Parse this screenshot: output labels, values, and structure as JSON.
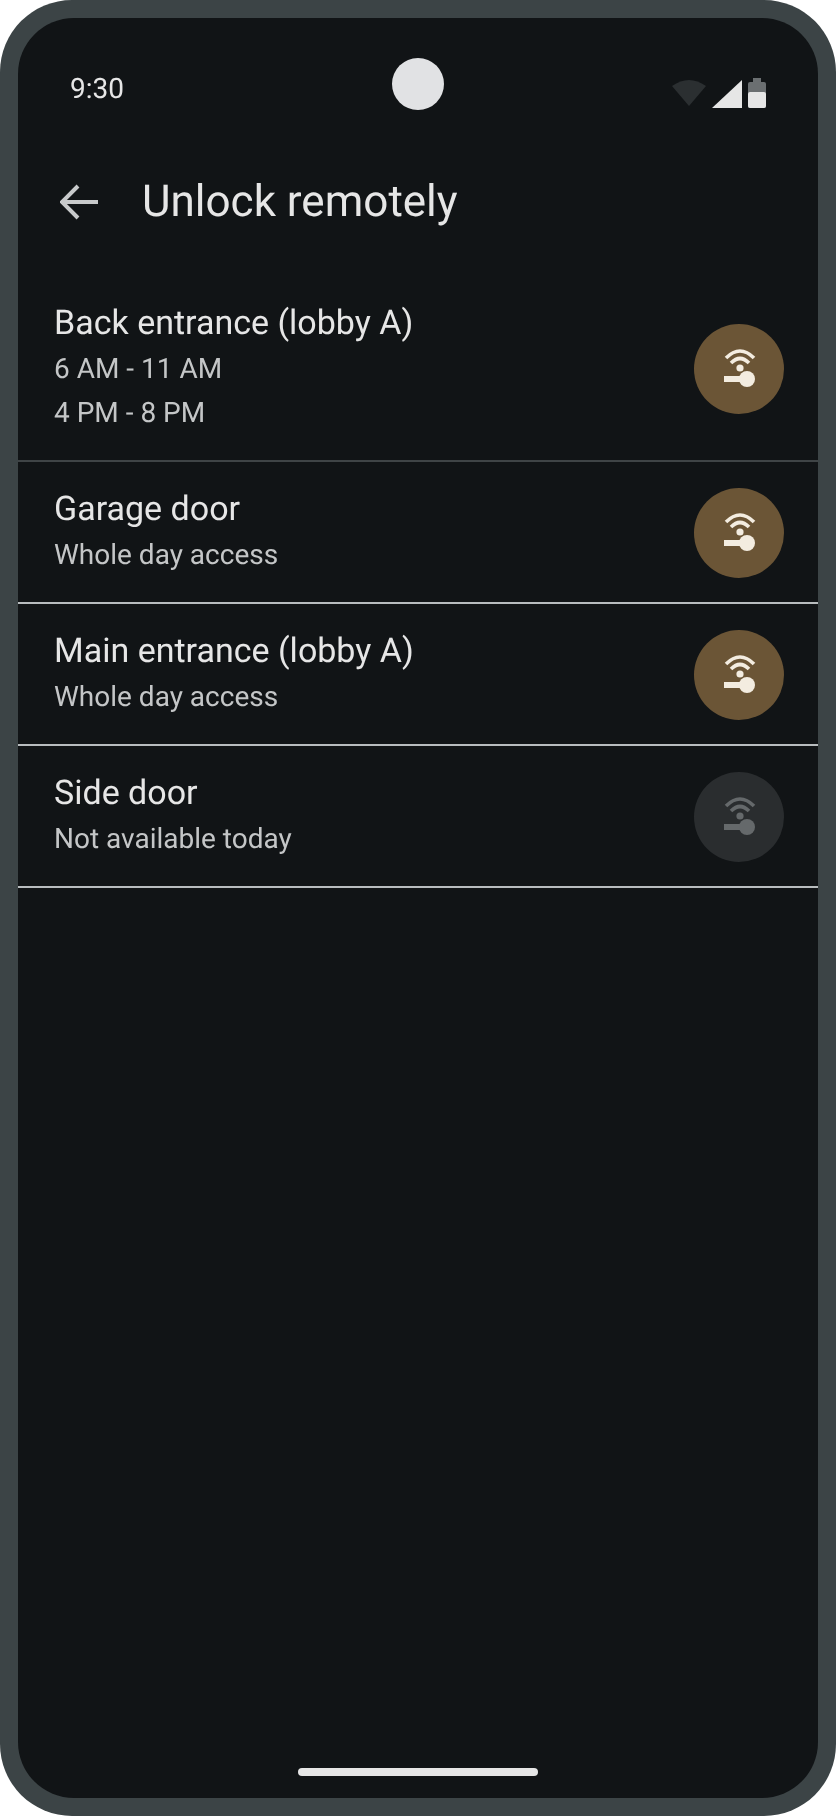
{
  "status_bar": {
    "time": "9:30"
  },
  "app_bar": {
    "title": "Unlock remotely"
  },
  "doors": [
    {
      "name": "Back entrance (lobby A)",
      "details": [
        "6 AM - 11 AM",
        "4 PM - 8 PM"
      ],
      "disabled": false
    },
    {
      "name": "Garage door",
      "details": [
        "Whole day access"
      ],
      "disabled": false
    },
    {
      "name": "Main entrance (lobby A)",
      "details": [
        "Whole day access"
      ],
      "disabled": false
    },
    {
      "name": "Side door",
      "details": [
        "Not available today"
      ],
      "disabled": true
    }
  ]
}
